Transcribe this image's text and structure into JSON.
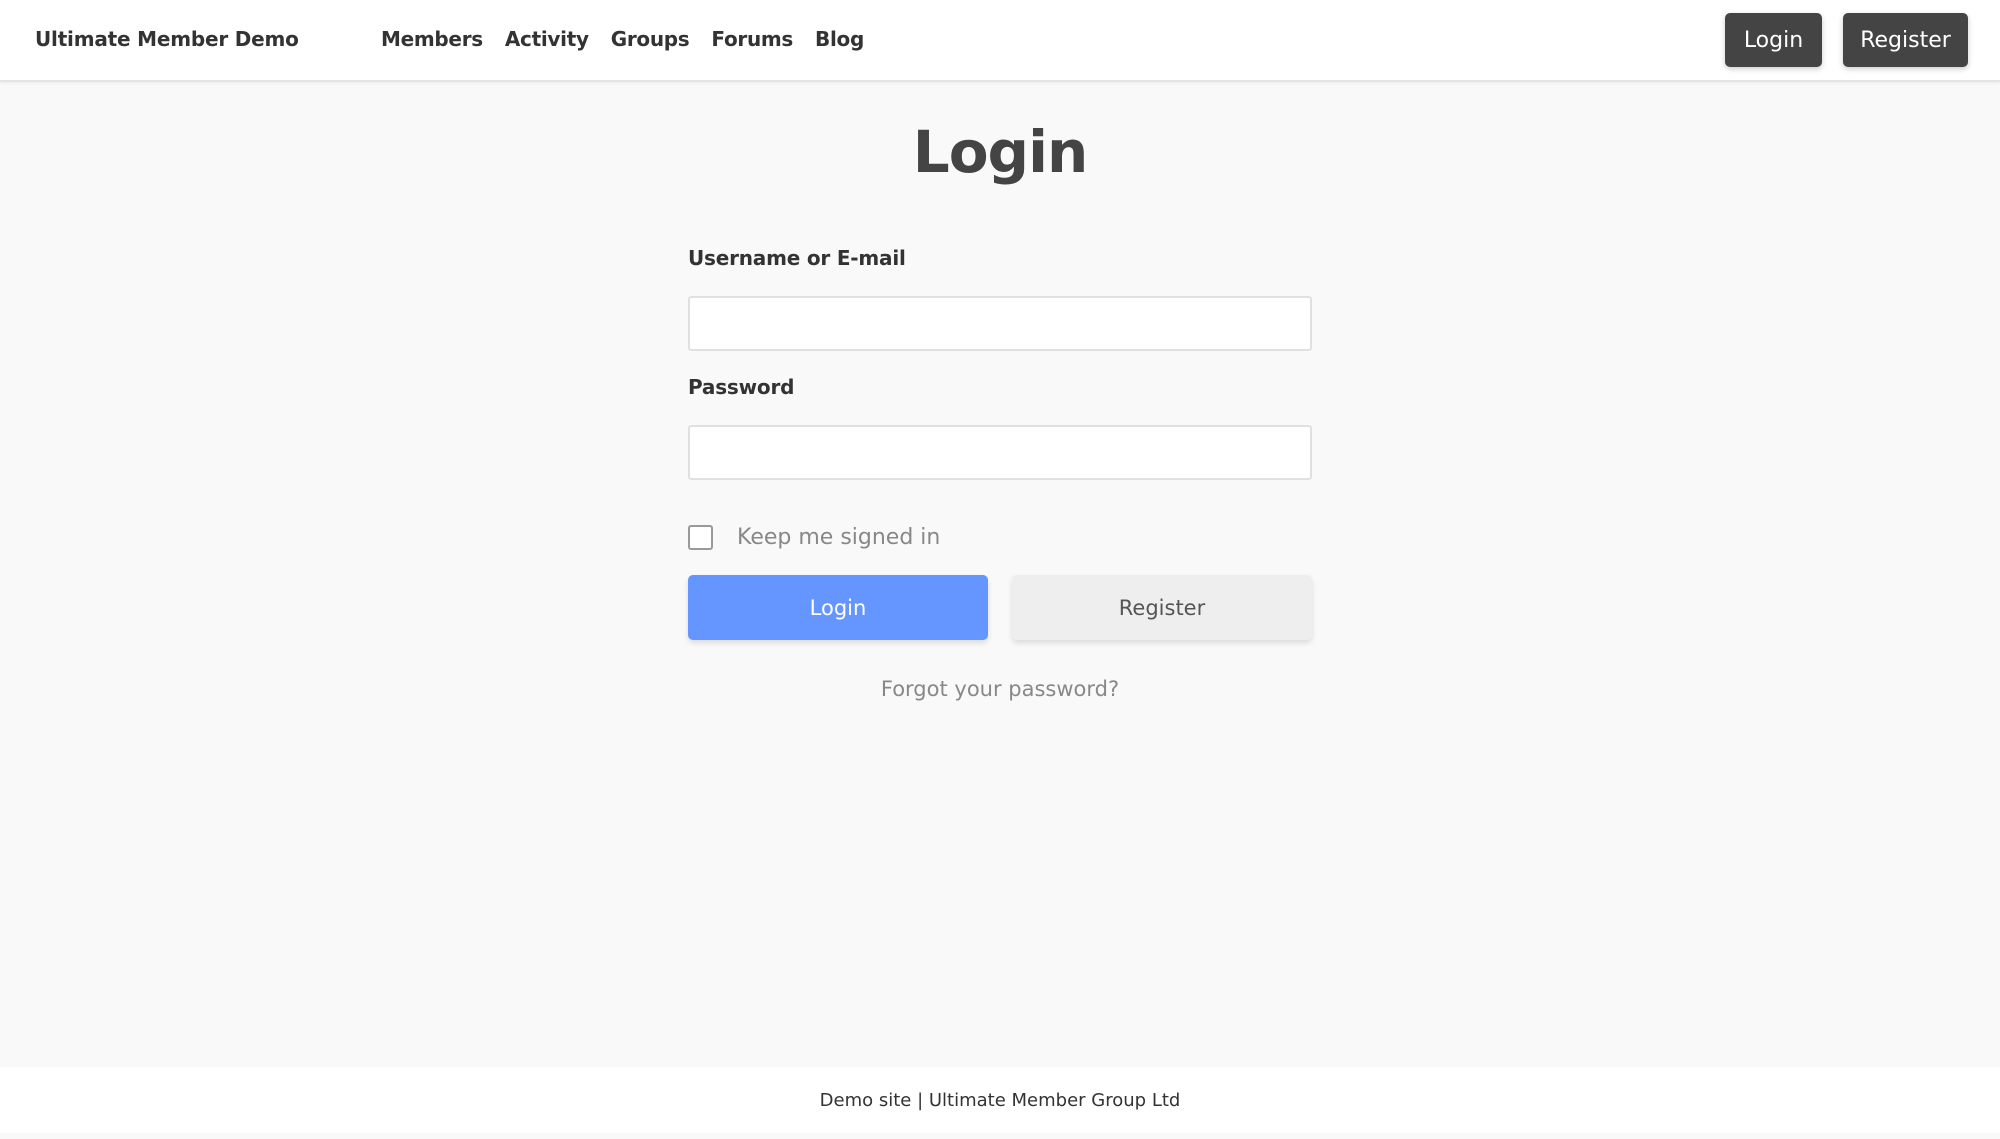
{
  "header": {
    "site_title": "Ultimate Member Demo",
    "nav": [
      {
        "label": "Members"
      },
      {
        "label": "Activity"
      },
      {
        "label": "Groups"
      },
      {
        "label": "Forums"
      },
      {
        "label": "Blog"
      }
    ],
    "login_label": "Login",
    "register_label": "Register"
  },
  "main": {
    "title": "Login",
    "username_label": "Username or E-mail",
    "username_value": "",
    "password_label": "Password",
    "password_value": "",
    "remember_label": "Keep me signed in",
    "remember_checked": false,
    "login_button": "Login",
    "register_button": "Register",
    "forgot_link": "Forgot your password?"
  },
  "footer": {
    "text": "Demo site | Ultimate Member Group Ltd"
  },
  "colors": {
    "accent": "#6596ff",
    "header_button": "#444444",
    "secondary_button": "#eeeeee",
    "background": "#f9f9f9"
  }
}
